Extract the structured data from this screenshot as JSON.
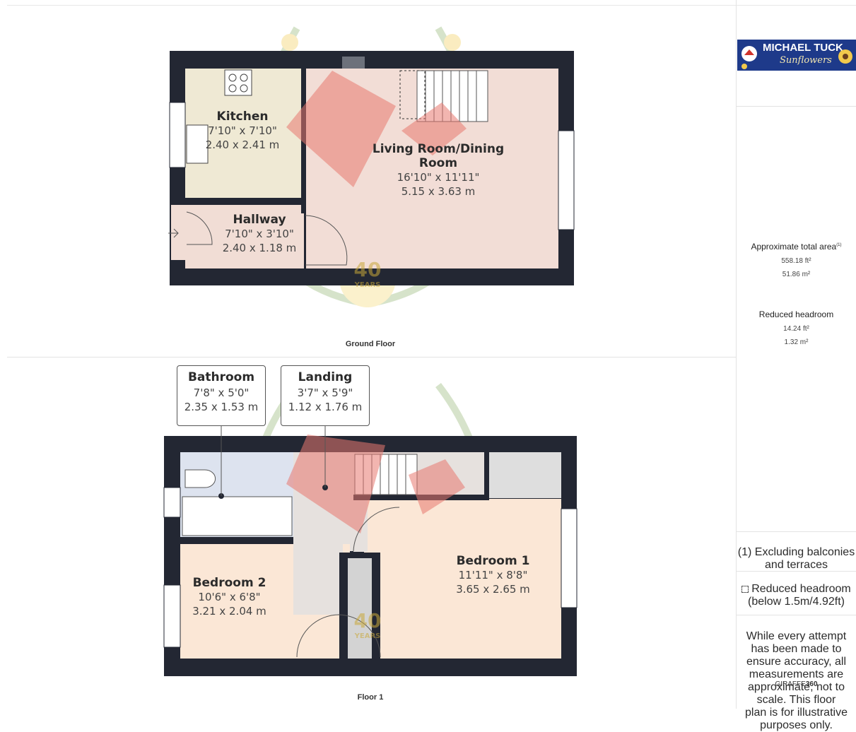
{
  "brand": {
    "name": "MICHAEL TUCK",
    "badge_text": "Sunflowers"
  },
  "ground_floor": {
    "label": "Ground Floor",
    "rooms": [
      {
        "name": "Kitchen",
        "imperial": "7'10\" x 7'10\"",
        "metric": "2.40 x 2.41 m"
      },
      {
        "name": "Living Room/Dining Room",
        "imperial": "16'10\" x 11'11\"",
        "metric": "5.15 x 3.63 m"
      },
      {
        "name": "Hallway",
        "imperial": "7'10\" x 3'10\"",
        "metric": "2.40 x 1.18 m"
      }
    ]
  },
  "floor_1": {
    "label": "Floor 1",
    "rooms": [
      {
        "name": "Bathroom",
        "imperial": "7'8\" x 5'0\"",
        "metric": "2.35 x 1.53 m"
      },
      {
        "name": "Landing",
        "imperial": "3'7\" x 5'9\"",
        "metric": "1.12 x 1.76 m"
      },
      {
        "name": "Bedroom 1",
        "imperial": "11'11\" x 8'8\"",
        "metric": "3.65 x 2.65 m"
      },
      {
        "name": "Bedroom 2",
        "imperial": "10'6\" x 6'8\"",
        "metric": "3.21 x 2.04 m"
      }
    ]
  },
  "watermark": {
    "number": "40",
    "word": "YEARS"
  },
  "summary": {
    "total_area_title": "Approximate total area",
    "total_area_marker": "(1)",
    "total_area_ft": "558.18 ft²",
    "total_area_m": "51.86 m²",
    "reduced_title": "Reduced headroom",
    "reduced_ft": "14.24 ft²",
    "reduced_m": "1.32 m²"
  },
  "notes": {
    "excluding": "(1) Excluding balconies and terraces",
    "legend_line1": "Reduced headroom",
    "legend_line2": "(below 1.5m/4.92ft)",
    "disclaimer_1": "While every attempt has been made to",
    "disclaimer_2": "ensure accuracy, all measurements are",
    "disclaimer_3": "approximate, not to scale. This floor",
    "disclaimer_4": "plan is for illustrative purposes only.",
    "credit_a": "GIRAFFE",
    "credit_b": "360"
  },
  "colors": {
    "wall": "#232733",
    "kitchen": "#efe9d4",
    "living": "#f2ddd6",
    "hallway": "#f1ddd5",
    "bathroom": "#dde3ef",
    "landing": "#e6e1de",
    "bedroom": "#fbe7d6",
    "highlight": "#e8796f"
  }
}
